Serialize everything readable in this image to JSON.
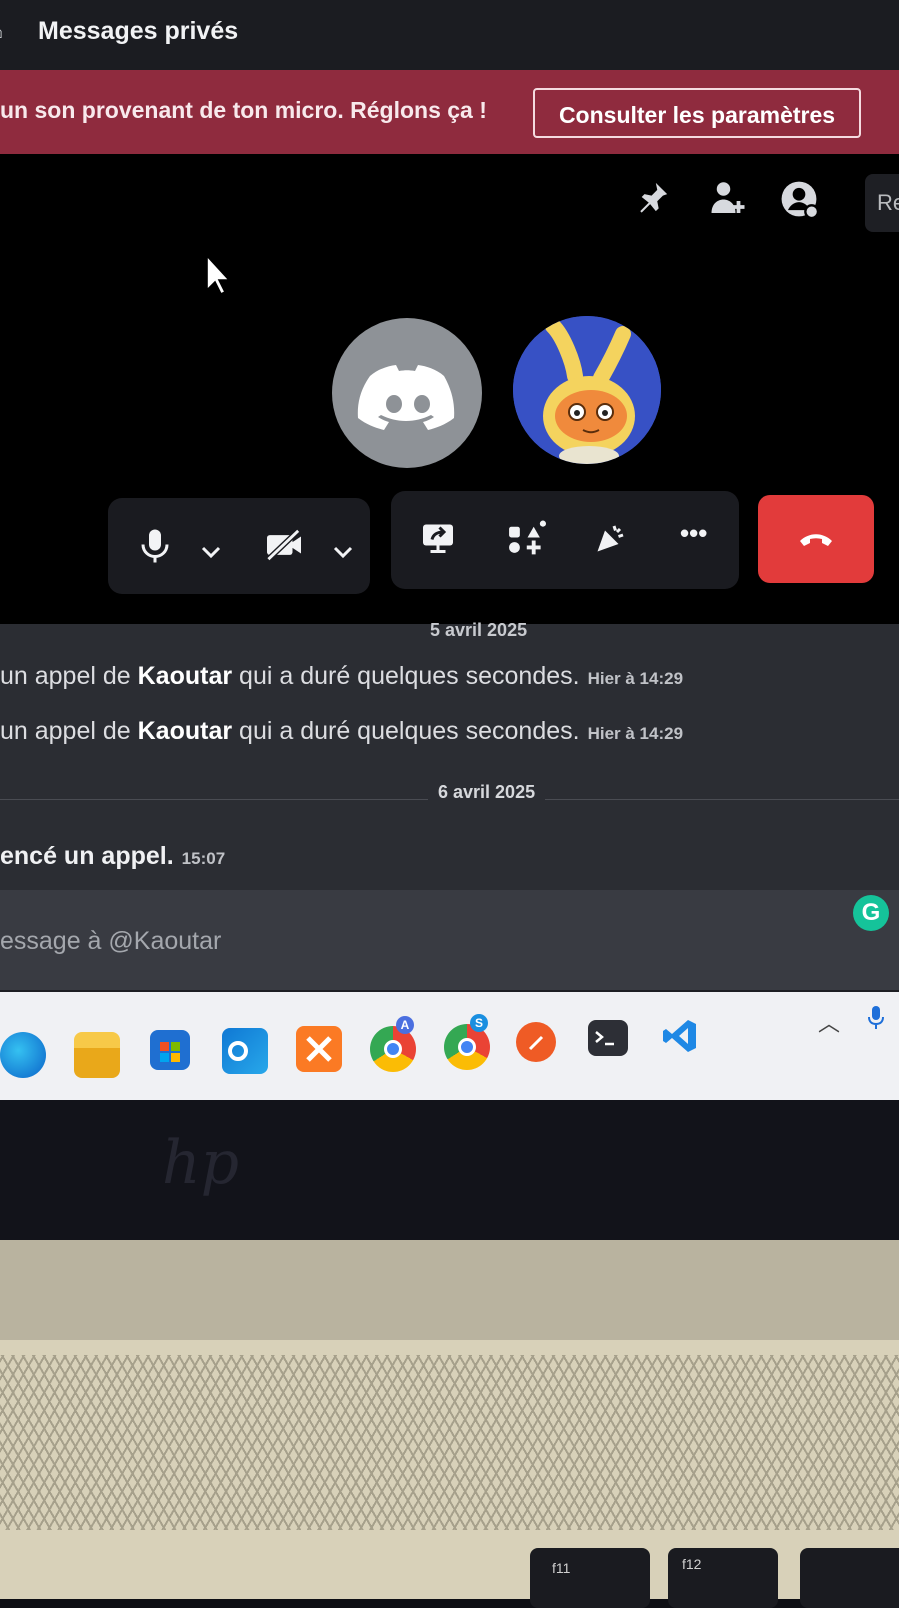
{
  "window": {
    "title": "Messages privés"
  },
  "banner": {
    "text": "un son provenant de ton micro. Réglons ça !",
    "button": "Consulter les paramètres"
  },
  "header_toolbar": {
    "icons": [
      "pin-icon",
      "add-friend-icon",
      "profile-icon"
    ],
    "search_partial": "Re"
  },
  "call": {
    "participants": [
      {
        "avatar": "discord-logo-icon"
      },
      {
        "avatar": "cartoon-bunny-avatar"
      }
    ],
    "controls": [
      "mic-icon",
      "chevron-down-icon",
      "camera-off-icon",
      "chevron-down-icon",
      "screen-share-icon",
      "activities-icon",
      "soundboard-icon",
      "more-icon",
      "hang-up-icon"
    ],
    "hangup_color": "#e23b3b"
  },
  "chat": {
    "date_top": "5 avril 2025",
    "messages": [
      {
        "prefix": "un appel de ",
        "name": "Kaoutar",
        "suffix": " qui a duré quelques secondes.",
        "time": "Hier à 14:29"
      },
      {
        "prefix": "un appel de ",
        "name": "Kaoutar",
        "suffix": " qui a duré quelques secondes.",
        "time": "Hier à 14:29"
      }
    ],
    "date_mid": "6 avril 2025",
    "last_message": {
      "text": "encé un appel.",
      "time": "15:07"
    }
  },
  "composer": {
    "placeholder": "essage à @Kaoutar",
    "grammarly": "G"
  },
  "taskbar": {
    "apps": [
      "edge-icon",
      "file-explorer-icon",
      "microsoft-store-icon",
      "outlook-icon",
      "xampp-icon",
      "chrome-profile-a-icon",
      "chrome-profile-s-icon",
      "postman-icon",
      "terminal-icon",
      "vscode-icon"
    ],
    "badges": {
      "chrome_a": "A",
      "chrome_s": "S"
    }
  },
  "laptop": {
    "keys": [
      "f11",
      "f12"
    ]
  }
}
